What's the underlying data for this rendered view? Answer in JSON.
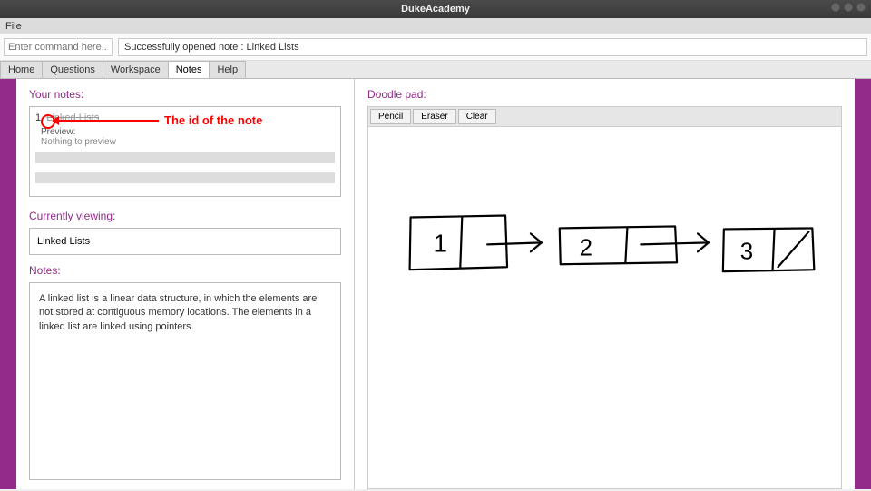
{
  "window": {
    "title": "DukeAcademy"
  },
  "menubar": {
    "file": "File"
  },
  "command": {
    "placeholder": "Enter command here...",
    "status": "Successfully opened note : Linked Lists"
  },
  "tabs": {
    "home": "Home",
    "questions": "Questions",
    "workspace": "Workspace",
    "notes": "Notes",
    "help": "Help"
  },
  "left": {
    "your_notes_heading": "Your notes:",
    "note1_id": "1.",
    "note1_title": "Linked Lists",
    "preview_label": "Preview:",
    "preview_text": "Nothing to preview",
    "currently_viewing_heading": "Currently viewing:",
    "currently_viewing_value": "Linked Lists",
    "notes_heading": "Notes:",
    "notes_body": "A linked list is a linear data structure, in which the elements are not stored at contiguous memory locations. The elements in a linked list are linked using pointers."
  },
  "right": {
    "doodle_heading": "Doodle pad:",
    "btn_pencil": "Pencil",
    "btn_eraser": "Eraser",
    "btn_clear": "Clear"
  },
  "annotation": {
    "label": "The id of the note"
  },
  "doodle_content": {
    "nodes": [
      "1",
      "2",
      "3"
    ]
  }
}
